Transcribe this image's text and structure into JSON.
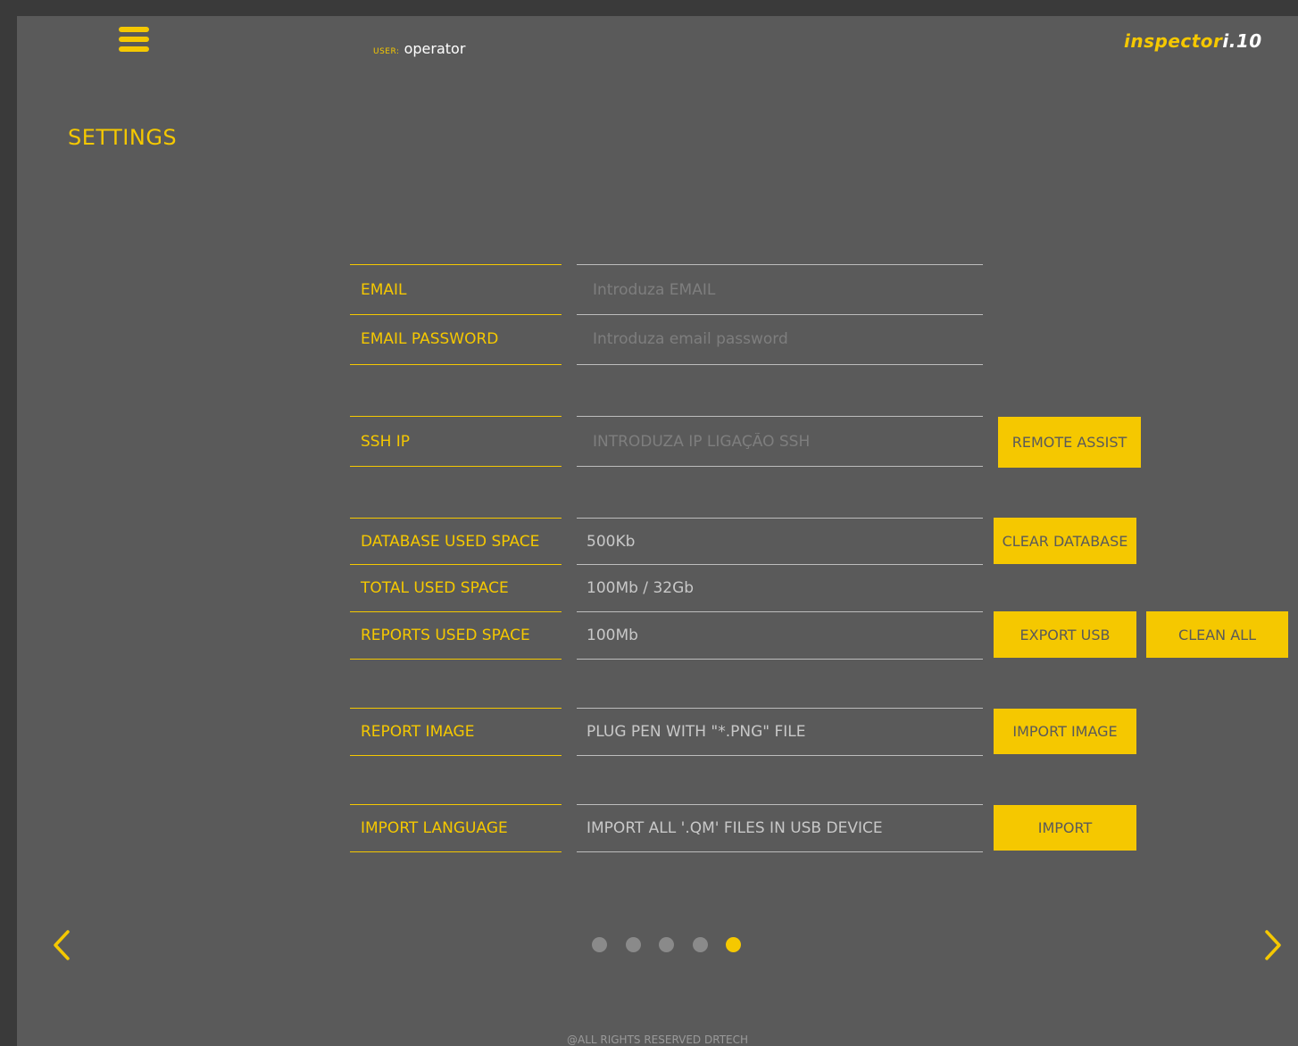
{
  "header": {
    "user_label": "USER:",
    "user_name": "operator",
    "logo_part1": "inspector",
    "logo_part2": "i.10"
  },
  "page_title": "SETTINGS",
  "email": {
    "label": "EMAIL",
    "placeholder": "Introduza EMAIL"
  },
  "email_password": {
    "label": "EMAIL PASSWORD",
    "placeholder": "Introduza email password"
  },
  "ssh": {
    "label": "SSH IP",
    "placeholder": "INTRODUZA IP LIGAÇÃO SSH",
    "button": "REMOTE ASSIST"
  },
  "database": {
    "label": "DATABASE USED SPACE",
    "value": "500Kb",
    "button": "CLEAR DATABASE"
  },
  "total": {
    "label": "TOTAL USED SPACE",
    "value": "100Mb / 32Gb"
  },
  "reports": {
    "label": "REPORTS USED SPACE",
    "value": "100Mb",
    "button_export": "EXPORT USB",
    "button_clean": "CLEAN ALL"
  },
  "report_image": {
    "label": "REPORT IMAGE",
    "value": "PLUG PEN WITH \"*.PNG\" FILE",
    "button": "IMPORT IMAGE"
  },
  "import_language": {
    "label": "IMPORT LANGUAGE",
    "value": "IMPORT ALL '.QM' FILES IN USB DEVICE",
    "button": "IMPORT"
  },
  "pagination": {
    "page_count": 5,
    "active_page": 5
  },
  "footer": "@ALL RIGHTS RESERVED DRTECH",
  "colors": {
    "accent": "#f5c800",
    "background": "#5a5a5a",
    "frame": "#3a3a3a"
  },
  "icons": {
    "menu": "hamburger-icon",
    "prev": "chevron-left-icon",
    "next": "chevron-right-icon"
  }
}
